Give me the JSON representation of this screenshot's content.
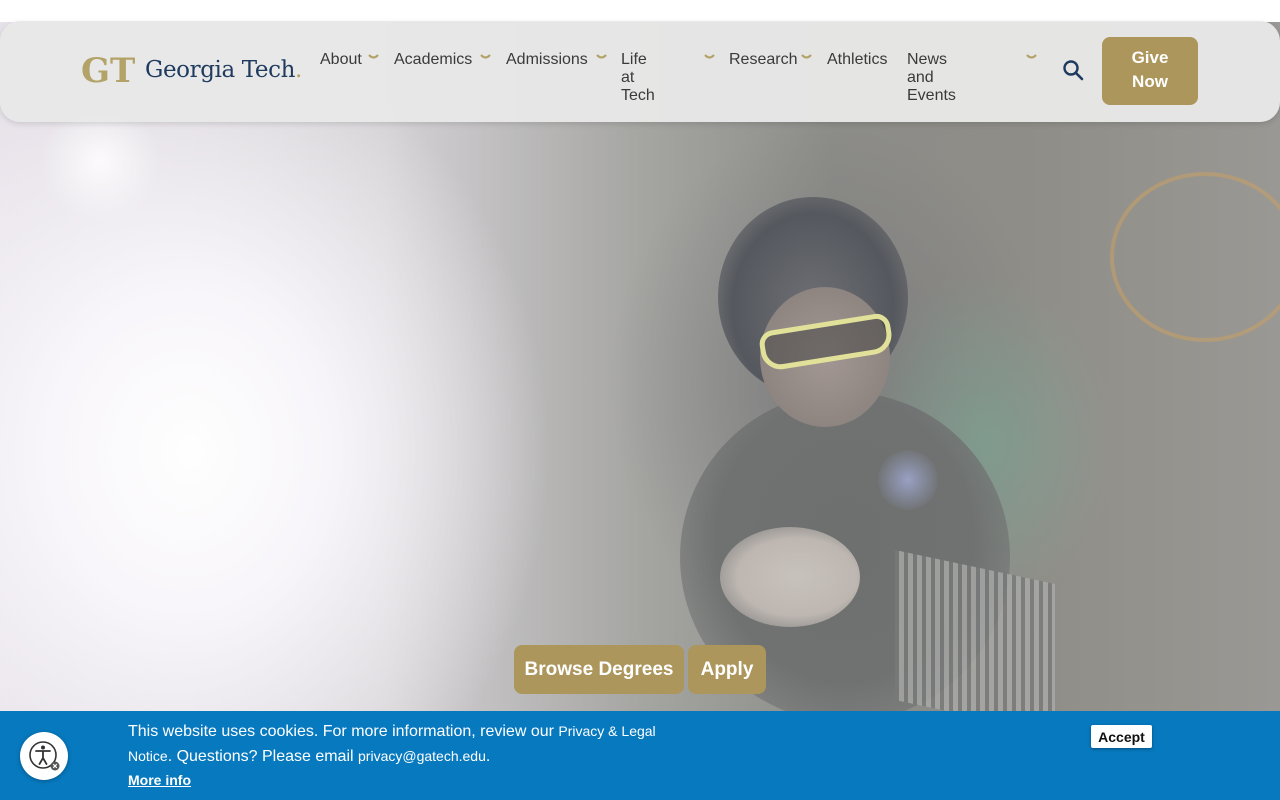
{
  "brand": {
    "name": "Georgia Tech",
    "mark": "GT",
    "colors": {
      "gold": "#ac965b",
      "navy": "#1f3a5f",
      "cookie_blue": "#0779bf"
    }
  },
  "nav": {
    "items": [
      {
        "label": "About",
        "has_menu": true
      },
      {
        "label": "Academics",
        "has_menu": true
      },
      {
        "label": "Admissions",
        "has_menu": true
      },
      {
        "label": "Life at\nTech",
        "has_menu": true
      },
      {
        "label": "Research",
        "has_menu": true
      },
      {
        "label": "Athletics",
        "has_menu": false
      },
      {
        "label": "News and\nEvents",
        "has_menu": true
      }
    ],
    "search_icon": "search-icon",
    "give_label": "Give\nNow"
  },
  "hero": {
    "image_alt": "",
    "browse_label": "Browse Degrees",
    "apply_label": "Apply"
  },
  "cookie_banner": {
    "text_1": "This website uses cookies. For more information, review our ",
    "link_1": "Privacy & Legal Notice",
    "text_2": ". Questions? Please email ",
    "email": "privacy@gatech.edu",
    "text_3": ".",
    "more_info": "More info",
    "accept": "Accept"
  },
  "accessibility_icon": "accessibility-icon"
}
